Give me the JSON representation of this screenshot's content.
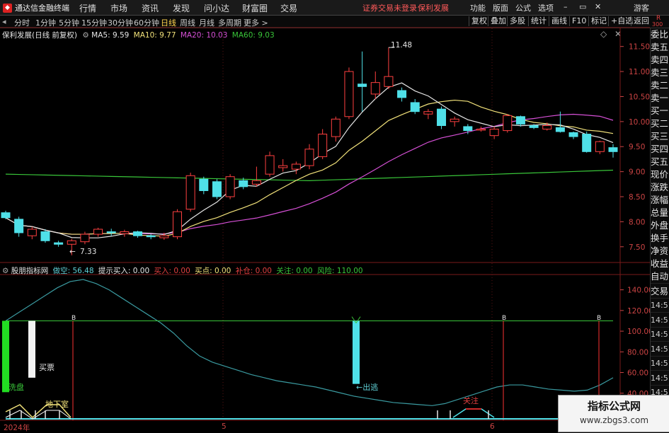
{
  "app_title": "通达信金融终端",
  "menu": [
    "行情",
    "市场",
    "资讯",
    "发现",
    "问小达",
    "财富圈",
    "交易"
  ],
  "notice": [
    "证券交易未登录",
    "保利发展"
  ],
  "right_menu": [
    "功能",
    "版面",
    "公式",
    "选项",
    "游客"
  ],
  "window_controls": [
    "–",
    "▭",
    "✕"
  ],
  "periods": [
    "分时",
    "1分钟",
    "5分钟",
    "15分钟",
    "30分钟",
    "60分钟",
    "日线",
    "周线",
    "月线",
    "多周期",
    "更多 >"
  ],
  "active_period": "日线",
  "toolbar": [
    "复权",
    "叠加",
    "多股",
    "统计",
    "画线",
    "F10",
    "标记",
    "+自选",
    "返回"
  ],
  "corner_labels": [
    "R",
    "300"
  ],
  "main_chart": {
    "title": "保利发展(日线 前复权)",
    "legend": [
      {
        "label": "MA5: 9.59",
        "color": "#e6e6e6"
      },
      {
        "label": "MA10: 9.77",
        "color": "#f2e27a"
      },
      {
        "label": "MA20: 10.03",
        "color": "#d650d6"
      },
      {
        "label": "MA60: 9.03",
        "color": "#39c639"
      }
    ],
    "high_label": "11.48",
    "low_label": "7.33",
    "y_ticks": [
      "11.50",
      "11.00",
      "10.50",
      "10.00",
      "9.50",
      "9.00",
      "8.50",
      "8.00",
      "7.50"
    ]
  },
  "indicator": {
    "title": "股朋指标网",
    "legend": [
      {
        "label": "做空: 56.48",
        "color": "#5fd0d6"
      },
      {
        "label": "提示买入: 0.00",
        "color": "#e6e6e6"
      },
      {
        "label": "买入: 0.00",
        "color": "#e04040"
      },
      {
        "label": "买点: 0.00",
        "color": "#f2e27a"
      },
      {
        "label": "补仓: 0.00",
        "color": "#e04040"
      },
      {
        "label": "关注: 0.00",
        "color": "#39c639"
      },
      {
        "label": "风险: 110.00",
        "color": "#39c639"
      }
    ],
    "y_ticks": [
      "140.00",
      "120.00",
      "100.00",
      "80.00",
      "60.00",
      "40.00"
    ],
    "annotations": [
      "洗盘",
      "买票",
      "←出逃",
      "地下室",
      "关注",
      "B",
      "B",
      "B"
    ]
  },
  "x_labels": [
    "2024年",
    "5",
    "6"
  ],
  "sidebar": [
    "委比",
    "卖五",
    "卖四",
    "卖三",
    "卖二",
    "卖一",
    "买一",
    "买二",
    "买三",
    "买四",
    "买五",
    "现价",
    "涨跌",
    "涨幅",
    "总量",
    "外盘",
    "换手",
    "净资",
    "收益"
  ],
  "sidebar_lower": [
    "自动",
    "交易",
    "14:5",
    "14:5",
    "14:5",
    "14:5",
    "14:5",
    "14:5",
    "14:5",
    "14:5",
    "14:5"
  ],
  "watermark": {
    "line1": "指标公式网",
    "line2": "www.zbgs3.com"
  },
  "colors": {
    "up": "#ff4040",
    "down": "#4fe0e8",
    "ma5": "#e6e6e6",
    "ma10": "#f2e27a",
    "ma20": "#d650d6",
    "ma60": "#39c639",
    "grid": "#7a1a1a"
  },
  "chart_data": {
    "type": "candlestick",
    "title": "保利发展(日线 前复权)",
    "candles": [
      {
        "o": 8.18,
        "c": 8.08,
        "h": 8.22,
        "l": 8.05
      },
      {
        "o": 8.05,
        "c": 7.78,
        "h": 8.1,
        "l": 7.7
      },
      {
        "o": 7.72,
        "c": 7.85,
        "h": 7.9,
        "l": 7.65
      },
      {
        "o": 7.8,
        "c": 7.62,
        "h": 7.85,
        "l": 7.58
      },
      {
        "o": 7.58,
        "c": 7.55,
        "h": 7.62,
        "l": 7.5
      },
      {
        "o": 7.55,
        "c": 7.62,
        "h": 7.66,
        "l": 7.33
      },
      {
        "o": 7.6,
        "c": 7.75,
        "h": 7.8,
        "l": 7.55
      },
      {
        "o": 7.75,
        "c": 7.85,
        "h": 7.88,
        "l": 7.7
      },
      {
        "o": 7.8,
        "c": 7.78,
        "h": 7.86,
        "l": 7.72
      },
      {
        "o": 7.76,
        "c": 7.8,
        "h": 7.84,
        "l": 7.7
      },
      {
        "o": 7.8,
        "c": 7.72,
        "h": 7.82,
        "l": 7.68
      },
      {
        "o": 7.72,
        "c": 7.7,
        "h": 7.75,
        "l": 7.65
      },
      {
        "o": 7.68,
        "c": 7.72,
        "h": 7.78,
        "l": 7.64
      },
      {
        "o": 7.7,
        "c": 8.2,
        "h": 8.25,
        "l": 7.65
      },
      {
        "o": 8.25,
        "c": 8.92,
        "h": 8.98,
        "l": 8.2
      },
      {
        "o": 8.85,
        "c": 8.62,
        "h": 8.9,
        "l": 8.55
      },
      {
        "o": 8.8,
        "c": 8.5,
        "h": 8.85,
        "l": 8.45
      },
      {
        "o": 8.5,
        "c": 8.9,
        "h": 8.95,
        "l": 8.45
      },
      {
        "o": 8.82,
        "c": 8.7,
        "h": 8.88,
        "l": 8.65
      },
      {
        "o": 8.75,
        "c": 8.82,
        "h": 9.1,
        "l": 8.7
      },
      {
        "o": 8.95,
        "c": 9.32,
        "h": 9.4,
        "l": 8.9
      },
      {
        "o": 9.08,
        "c": 9.12,
        "h": 9.25,
        "l": 9.0
      },
      {
        "o": 9.05,
        "c": 9.15,
        "h": 9.2,
        "l": 8.95
      },
      {
        "o": 9.12,
        "c": 9.45,
        "h": 9.55,
        "l": 9.05
      },
      {
        "o": 9.3,
        "c": 9.75,
        "h": 9.85,
        "l": 9.25
      },
      {
        "o": 9.7,
        "c": 10.05,
        "h": 10.1,
        "l": 9.6
      },
      {
        "o": 10.1,
        "c": 11.0,
        "h": 11.08,
        "l": 10.05
      },
      {
        "o": 10.75,
        "c": 10.7,
        "h": 11.4,
        "l": 10.2
      },
      {
        "o": 10.55,
        "c": 10.78,
        "h": 11.0,
        "l": 10.45
      },
      {
        "o": 10.7,
        "c": 10.9,
        "h": 11.48,
        "l": 10.65
      },
      {
        "o": 10.62,
        "c": 10.48,
        "h": 10.68,
        "l": 10.4
      },
      {
        "o": 10.38,
        "c": 10.2,
        "h": 10.45,
        "l": 10.15
      },
      {
        "o": 10.15,
        "c": 10.2,
        "h": 10.25,
        "l": 10.05
      },
      {
        "o": 10.25,
        "c": 9.92,
        "h": 10.3,
        "l": 9.85
      },
      {
        "o": 10.0,
        "c": 10.05,
        "h": 10.1,
        "l": 9.9
      },
      {
        "o": 9.9,
        "c": 9.82,
        "h": 9.95,
        "l": 9.75
      },
      {
        "o": 9.85,
        "c": 9.85,
        "h": 9.9,
        "l": 9.8
      },
      {
        "o": 9.72,
        "c": 9.85,
        "h": 9.9,
        "l": 9.65
      },
      {
        "o": 9.82,
        "c": 10.12,
        "h": 10.15,
        "l": 9.78
      },
      {
        "o": 10.1,
        "c": 9.95,
        "h": 10.12,
        "l": 9.9
      },
      {
        "o": 9.92,
        "c": 9.88,
        "h": 9.95,
        "l": 9.85
      },
      {
        "o": 9.85,
        "c": 9.92,
        "h": 9.98,
        "l": 9.82
      },
      {
        "o": 9.88,
        "c": 9.8,
        "h": 10.2,
        "l": 9.78
      },
      {
        "o": 9.78,
        "c": 9.7,
        "h": 9.8,
        "l": 9.65
      },
      {
        "o": 9.75,
        "c": 9.4,
        "h": 9.8,
        "l": 9.38
      },
      {
        "o": 9.4,
        "c": 9.6,
        "h": 9.62,
        "l": 9.35
      },
      {
        "o": 9.48,
        "c": 9.4,
        "h": 9.55,
        "l": 9.28
      }
    ],
    "ma60": {
      "start": 8.95,
      "mid": 8.82,
      "end": 9.03
    },
    "ylim": [
      7.2,
      11.75
    ],
    "indicator_ylim": [
      20,
      150
    ],
    "indicator_line": [
      110,
      118,
      126,
      134,
      142,
      148,
      150,
      146,
      140,
      132,
      124,
      116,
      108,
      98,
      86,
      76,
      70,
      66,
      62,
      58,
      55,
      52,
      50,
      48,
      46,
      43,
      40,
      37,
      35,
      33,
      31,
      30,
      29,
      28,
      30,
      34,
      38,
      42,
      46,
      48,
      48,
      46,
      44,
      43,
      42,
      43,
      48,
      55
    ]
  }
}
